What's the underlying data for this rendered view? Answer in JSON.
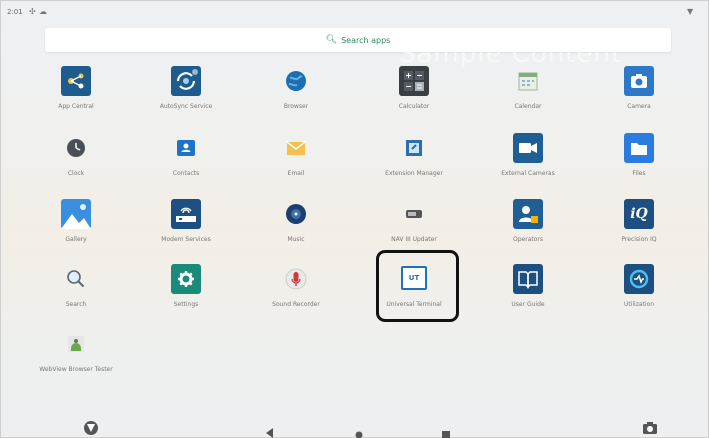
{
  "status_bar": {
    "time": "2:01"
  },
  "search": {
    "label": "Search apps"
  },
  "watermark": "Sample Content",
  "apps": [
    {
      "label": "App Central",
      "icon": "app-central-icon"
    },
    {
      "label": "AutoSync Service",
      "icon": "autosync-icon"
    },
    {
      "label": "Browser",
      "icon": "browser-globe-icon"
    },
    {
      "label": "Calculator",
      "icon": "calculator-icon"
    },
    {
      "label": "Calendar",
      "icon": "calendar-icon"
    },
    {
      "label": "Camera",
      "icon": "camera-icon"
    },
    {
      "label": "Clock",
      "icon": "clock-icon"
    },
    {
      "label": "Contacts",
      "icon": "contacts-icon"
    },
    {
      "label": "Email",
      "icon": "email-icon"
    },
    {
      "label": "Extension Manager",
      "icon": "extension-manager-icon"
    },
    {
      "label": "External Cameras",
      "icon": "external-cameras-icon"
    },
    {
      "label": "Files",
      "icon": "files-icon"
    },
    {
      "label": "Gallery",
      "icon": "gallery-icon"
    },
    {
      "label": "Modem Services",
      "icon": "modem-services-icon"
    },
    {
      "label": "Music",
      "icon": "music-icon"
    },
    {
      "label": "NAV III Updater",
      "icon": "nav-updater-icon"
    },
    {
      "label": "Operators",
      "icon": "operators-icon"
    },
    {
      "label": "Precision IQ",
      "icon": "precision-iq-icon",
      "text": "iQ"
    },
    {
      "label": "Search",
      "icon": "search-app-icon"
    },
    {
      "label": "Settings",
      "icon": "settings-gear-icon"
    },
    {
      "label": "Sound Recorder",
      "icon": "sound-recorder-icon"
    },
    {
      "label": "Universal Terminal",
      "icon": "universal-terminal-icon",
      "text": "UT"
    },
    {
      "label": "User Guide",
      "icon": "user-guide-icon"
    },
    {
      "label": "Utilization",
      "icon": "utilization-icon"
    },
    {
      "label": "WebView Browser Tester",
      "icon": "webview-tester-icon"
    }
  ],
  "colors": {
    "accent": "#2b8a5a",
    "brand_blue": "#1d5c8c",
    "teal": "#1a8a7a"
  }
}
